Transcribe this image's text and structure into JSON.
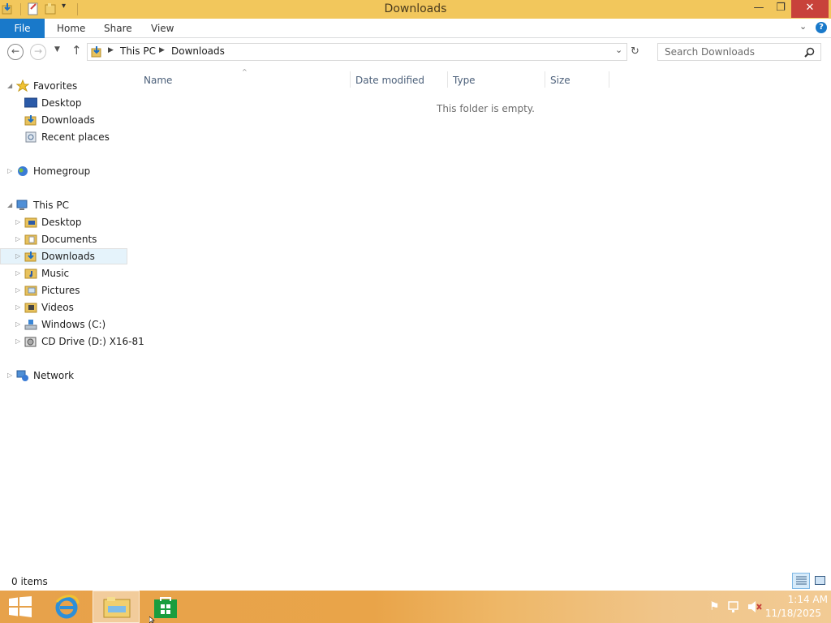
{
  "window": {
    "title": "Downloads"
  },
  "ribbon": {
    "tabs": [
      "File",
      "Home",
      "Share",
      "View"
    ]
  },
  "address": {
    "segments": [
      "This PC",
      "Downloads"
    ]
  },
  "search": {
    "placeholder": "Search Downloads"
  },
  "nav": {
    "favorites": {
      "label": "Favorites",
      "items": [
        "Desktop",
        "Downloads",
        "Recent places"
      ]
    },
    "homegroup": {
      "label": "Homegroup"
    },
    "thispc": {
      "label": "This PC",
      "items": [
        "Desktop",
        "Documents",
        "Downloads",
        "Music",
        "Pictures",
        "Videos",
        "Windows (C:)",
        "CD Drive (D:) X16-81"
      ]
    },
    "network": {
      "label": "Network"
    }
  },
  "columns": [
    "Name",
    "Date modified",
    "Type",
    "Size"
  ],
  "content": {
    "empty_text": "This folder is empty."
  },
  "status": {
    "items": "0 items"
  },
  "taskbar": {
    "time": "1:14 AM",
    "date": "11/18/2025"
  },
  "colors": {
    "accent": "#1979ca",
    "titlebar": "#f2c75c",
    "selected": "#e5f3fb"
  }
}
